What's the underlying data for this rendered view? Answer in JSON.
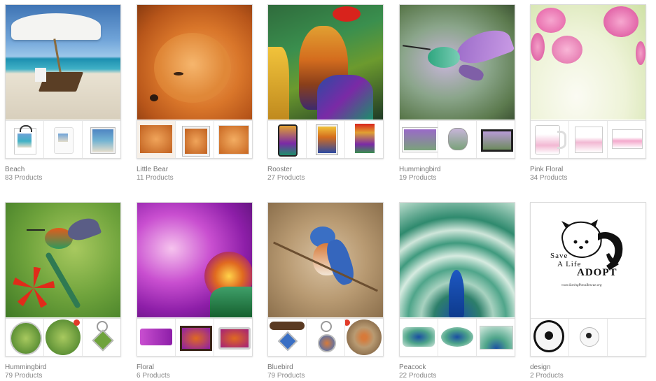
{
  "collections": [
    {
      "name": "Beach",
      "count": "83 Products"
    },
    {
      "name": "Little Bear",
      "count": "11 Products"
    },
    {
      "name": "Rooster",
      "count": "27 Products"
    },
    {
      "name": "Hummingbird",
      "count": "19 Products"
    },
    {
      "name": "Pink Floral",
      "count": "34 Products"
    },
    {
      "name": "Hummingbird",
      "count": "79 Products"
    },
    {
      "name": "Floral",
      "count": "6 Products"
    },
    {
      "name": "Bluebird",
      "count": "79 Products"
    },
    {
      "name": "Peacock",
      "count": "22 Products"
    },
    {
      "name": "design",
      "count": "2 Products"
    }
  ],
  "design_logo": {
    "line1": "Save",
    "line2": "A Life",
    "line3": "ADOPT",
    "url": "www.SavingPawsRescue.org"
  },
  "colors": {
    "card_border": "#dcdcdc",
    "label_text": "#777777",
    "sale_badge": "#e23b2a"
  }
}
